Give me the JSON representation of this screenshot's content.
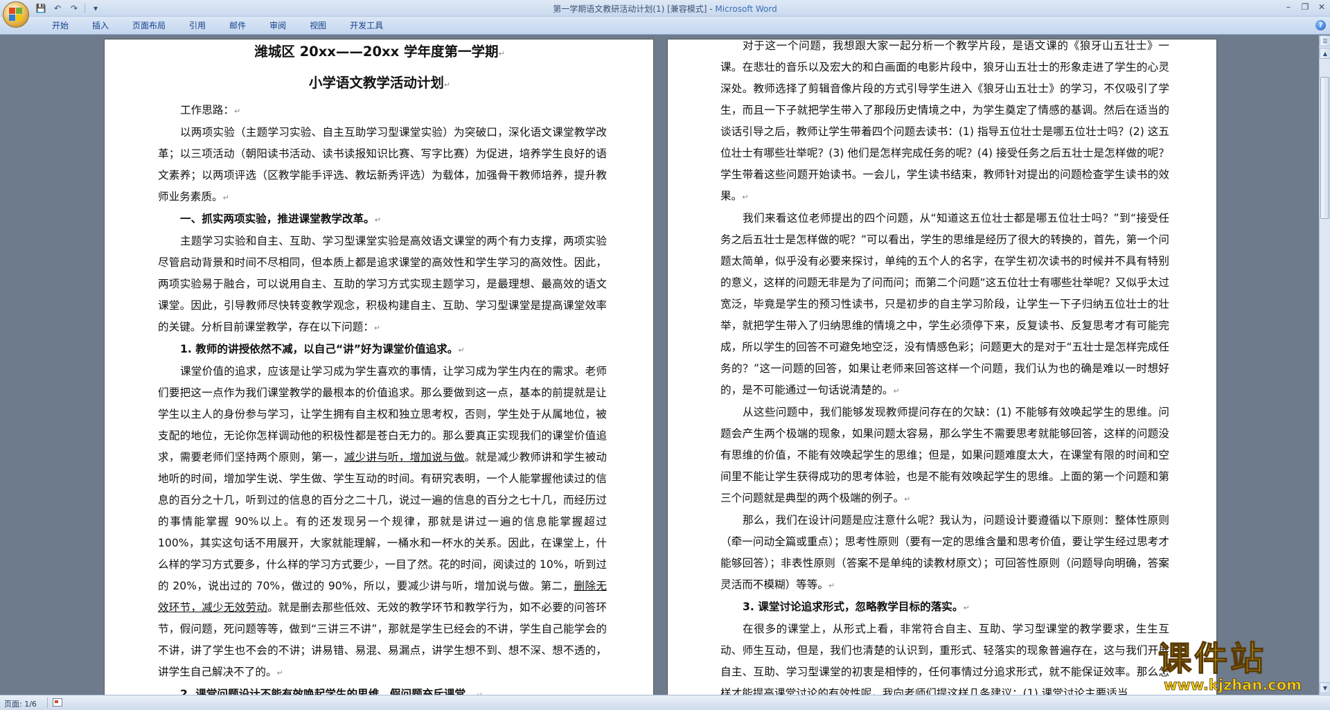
{
  "window": {
    "title": "第一学期语文教研活动计划(1) [兼容模式] - ",
    "app_name": "Microsoft Word"
  },
  "ribbon": {
    "tabs": [
      "开始",
      "插入",
      "页面布局",
      "引用",
      "邮件",
      "审阅",
      "视图",
      "开发工具"
    ]
  },
  "status": {
    "page": "页面: 1/6"
  },
  "watermark": {
    "main": "课件站",
    "sub": "www.kjzhan.com"
  },
  "left_page": {
    "title1": "潍城区 20xx——20xx 学年度第一学期",
    "title2": "小学语文教学活动计划",
    "p1": "工作思路：",
    "p2": "以两项实验（主题学习实验、自主互助学习型课堂实验）为突破口，深化语文课堂教学改革；以三项活动（朝阳读书活动、读书读报知识比赛、写字比赛）为促进，培养学生良好的语文素养；以两项评选（区教学能手评选、教坛新秀评选）为载体，加强骨干教师培养，提升教师业务素质。",
    "p3": "一、抓实两项实验，推进课堂教学改革。",
    "p4": "主题学习实验和自主、互助、学习型课堂实验是高效语文课堂的两个有力支撑，两项实验尽管启动背景和时间不尽相同，但本质上都是追求课堂的高效性和学生学习的高效性。因此，两项实验易于融合，可以说用自主、互助的学习方式实现主题学习，是最理想、最高效的语文课堂。因此，引导教师尽快转变教学观念，积极构建自主、互助、学习型课堂是提高课堂效率的关键。分析目前课堂教学，存在以下问题：",
    "p5": "1. 教师的讲授依然不减，以自己“讲”好为课堂价值追求。",
    "p6a": "课堂价值的追求，应该是让学习成为学生喜欢的事情，让学习成为学生内在的需求。老师们要把这一点作为我们课堂教学的最根本的价值追求。那么要做到这一点，基本的前提就是让学生以主人的身份参与学习，让学生拥有自主权和独立思考权，否则，学生处于从属地位，被支配的地位，无论你怎样调动他的积极性都是苍白无力的。那么要真正实现我们的课堂价值追求，需要老师们坚持两个原则，第一，",
    "p6b": "减少讲与听，增加说与做",
    "p6c": "。就是减少教师讲和学生被动地听的时间，增加学生说、学生做、学生互动的时间。有研究表明，一个人能掌握他读过的信息的百分之十几，听到过的信息的百分之二十几，说过一遍的信息的百分之七十几，而经历过的事情能掌握 90%以上。有的还发现另一个规律，那就是讲过一遍的信息能掌握超过 100%，其实这句话不用展开，大家就能理解，一桶水和一杯水的关系。因此，在课堂上，什么样的学习方式要多，什么样的学习方式要少，一目了然。花的时间，阅读过的 10%，听到过的 20%，说出过的 70%，做过的 90%，所以，要减少讲与听，增加说与做。第二，",
    "p6d": "删除无效环节，减少无效劳动",
    "p6e": "。就是删去那些低效、无效的教学环节和教学行为，如不必要的问答环节，假问题，死问题等等，做到“三讲三不讲”，那就是学生已经会的不讲，学生自己能学会的不讲，讲了学生也不会的不讲；讲易错、易混、易漏点，讲学生想不到、想不深、想不透的，讲学生自己解决不了的。",
    "p7": "2. 课堂问题设计不能有效唤起学生的思维，假问题充斥课堂。"
  },
  "right_page": {
    "p1": "对于这一个问题，我想跟大家一起分析一个教学片段，是语文课的《狼牙山五壮士》一课。在悲壮的音乐以及宏大的和白画面的电影片段中，狼牙山五壮士的形象走进了学生的心灵深处。教师选择了剪辑音像片段的方式引导学生进入《狼牙山五壮士》的学习，不仅吸引了学生，而且一下子就把学生带入了那段历史情境之中，为学生奠定了情感的基调。然后在适当的谈话引导之后，教师让学生带着四个问题去读书：(1) 指导五位壮士是哪五位壮士吗？(2) 这五位壮士有哪些壮举呢？(3) 他们是怎样完成任务的呢？(4) 接受任务之后五壮士是怎样做的呢？学生带着这些问题开始读书。一会儿，学生读书结束，教师针对提出的问题检查学生读书的效果。",
    "p2": "我们来看这位老师提出的四个问题，从“知道这五位壮士都是哪五位壮士吗？”到“接受任务之后五壮士是怎样做的呢？”可以看出，学生的思维是经历了很大的转换的，首先，第一个问题太简单，似乎没有必要来探讨，单纯的五个人的名字，在学生初次读书的时候并不具有特别的意义，这样的问题无非是为了问而问；而第二个问题“这五位壮士有哪些壮举呢？又似乎太过宽泛，毕竟是学生的预习性读书，只是初步的自主学习阶段，让学生一下子归纳五位壮士的壮举，就把学生带入了归纳思维的情境之中，学生必须停下来，反复读书、反复思考才有可能完成，所以学生的回答不可避免地空泛，没有情感色彩；问题更大的是对于“五壮士是怎样完成任务的？”这一问题的回答，如果让老师来回答这样一个问题，我们认为也的确是难以一时想好的，是不可能通过一句话说清楚的。",
    "p3": "从这些问题中，我们能够发现教师提问存在的欠缺：(1) 不能够有效唤起学生的思维。问题会产生两个极端的现象，如果问题太容易，那么学生不需要思考就能够回答，这样的问题没有思维的价值，不能有效唤起学生的思维；但是，如果问题难度太大，在课堂有限的时间和空间里不能让学生获得成功的思考体验，也是不能有效唤起学生的思维。上面的第一个问题和第三个问题就是典型的两个极端的例子。",
    "p4": "那么，我们在设计问题是应注意什么呢？我认为，问题设计要遵循以下原则：整体性原则（牵一问动全篇或重点）；思考性原则（要有一定的思维含量和思考价值，要让学生经过思考才能够回答）；非表性原则（答案不是单纯的读教材原文）；可回答性原则（问题导向明确，答案灵活而不模糊）等等。",
    "p5": "3. 课堂讨论追求形式，忽略教学目标的落实。",
    "p6": "在很多的课堂上，从形式上看，非常符合自主、互助、学习型课堂的教学要求，生生互动、师生互动，但是，我们也清楚的认识到，重形式、轻落实的现象普遍存在，这与我们开展自主、互助、学习型课堂的初衷是相悖的，任何事情过分追求形式，就不能保证效率。那么怎样才能提高课堂讨论的有效性呢，我向老师们提这样几条建议：(1) 课堂讨论主要适当"
  }
}
